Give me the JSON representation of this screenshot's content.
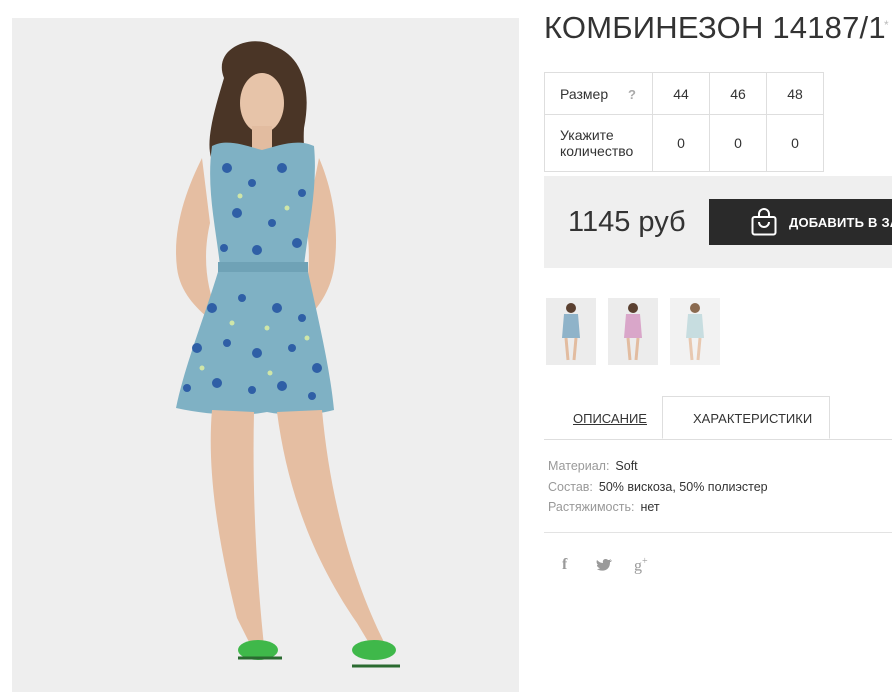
{
  "product": {
    "title": "КОМБИНЕЗОН 14187/1",
    "price": "1145 руб"
  },
  "sizes_table": {
    "size_label": "Размер",
    "help": "?",
    "sizes": [
      "44",
      "46",
      "48"
    ],
    "qty_label": "Укажите количество",
    "quantities": [
      "0",
      "0",
      "0"
    ]
  },
  "cart": {
    "button_label": "ДОБАВИТЬ В ЗАКАЗ",
    "icon": "shopping-bag-icon"
  },
  "thumbnails": [
    {
      "name": "thumbnail-blue-print",
      "color": "#8fb3c9"
    },
    {
      "name": "thumbnail-pink",
      "color": "#d9a6c9"
    },
    {
      "name": "thumbnail-light-blue",
      "color": "#c7dde0"
    }
  ],
  "tabs": [
    {
      "label": "ОПИСАНИЕ",
      "active": false
    },
    {
      "label": "ХАРАКТЕРИСТИКИ",
      "active": true
    }
  ],
  "specs": [
    {
      "key": "Материал:",
      "value": "Soft"
    },
    {
      "key": "Состав:",
      "value": "50% вискоза, 50% полиэстер"
    },
    {
      "key": "Растяжимость:",
      "value": "нет"
    }
  ],
  "social": [
    "facebook-icon",
    "twitter-icon",
    "google-plus-icon"
  ],
  "colors": {
    "dress": "#7fb1c4",
    "dress_print": "#2f5fa6",
    "sandals": "#3fb84a",
    "button_bg": "#2a2a2a",
    "panel_bg": "#efefef"
  }
}
